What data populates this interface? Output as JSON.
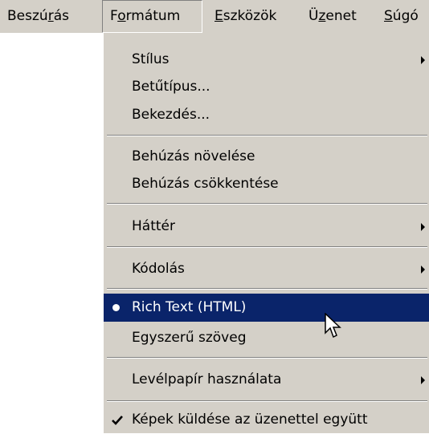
{
  "menubar": {
    "items": [
      {
        "pre": "Beszú",
        "u": "r",
        "post": "ás"
      },
      {
        "pre": "F",
        "u": "o",
        "post": "rmátum"
      },
      {
        "pre": "",
        "u": "E",
        "post": "szközök"
      },
      {
        "pre": "Ü",
        "u": "z",
        "post": "enet"
      },
      {
        "pre": "",
        "u": "S",
        "post": "úgó"
      }
    ]
  },
  "format_menu": {
    "items": [
      {
        "label": "Stílus",
        "submenu": true
      },
      {
        "label": "Betűtípus...",
        "submenu": false
      },
      {
        "label": "Bekezdés...",
        "submenu": false
      },
      {
        "label": "Behúzás növelése",
        "submenu": false
      },
      {
        "label": "Behúzás csökkentése",
        "submenu": false
      },
      {
        "label": "Háttér",
        "submenu": true
      },
      {
        "label": "Kódolás",
        "submenu": true
      },
      {
        "label": "Rich Text (HTML)",
        "submenu": false,
        "selected": true,
        "highlighted": true
      },
      {
        "label": "Egyszerű szöveg",
        "submenu": false
      },
      {
        "label": "Levélpapír használata",
        "submenu": true
      },
      {
        "label": "Képek küldése az üzenettel együtt",
        "submenu": false,
        "checked": true
      }
    ]
  },
  "colors": {
    "menu_background": "#d4d0c8",
    "highlight": "#0a246a",
    "highlight_text": "#ffffff"
  },
  "icons": {
    "bullet": "radio-bullet-icon",
    "check": "checkmark-icon",
    "arrow": "submenu-arrow-icon",
    "cursor": "mouse-pointer-icon"
  }
}
